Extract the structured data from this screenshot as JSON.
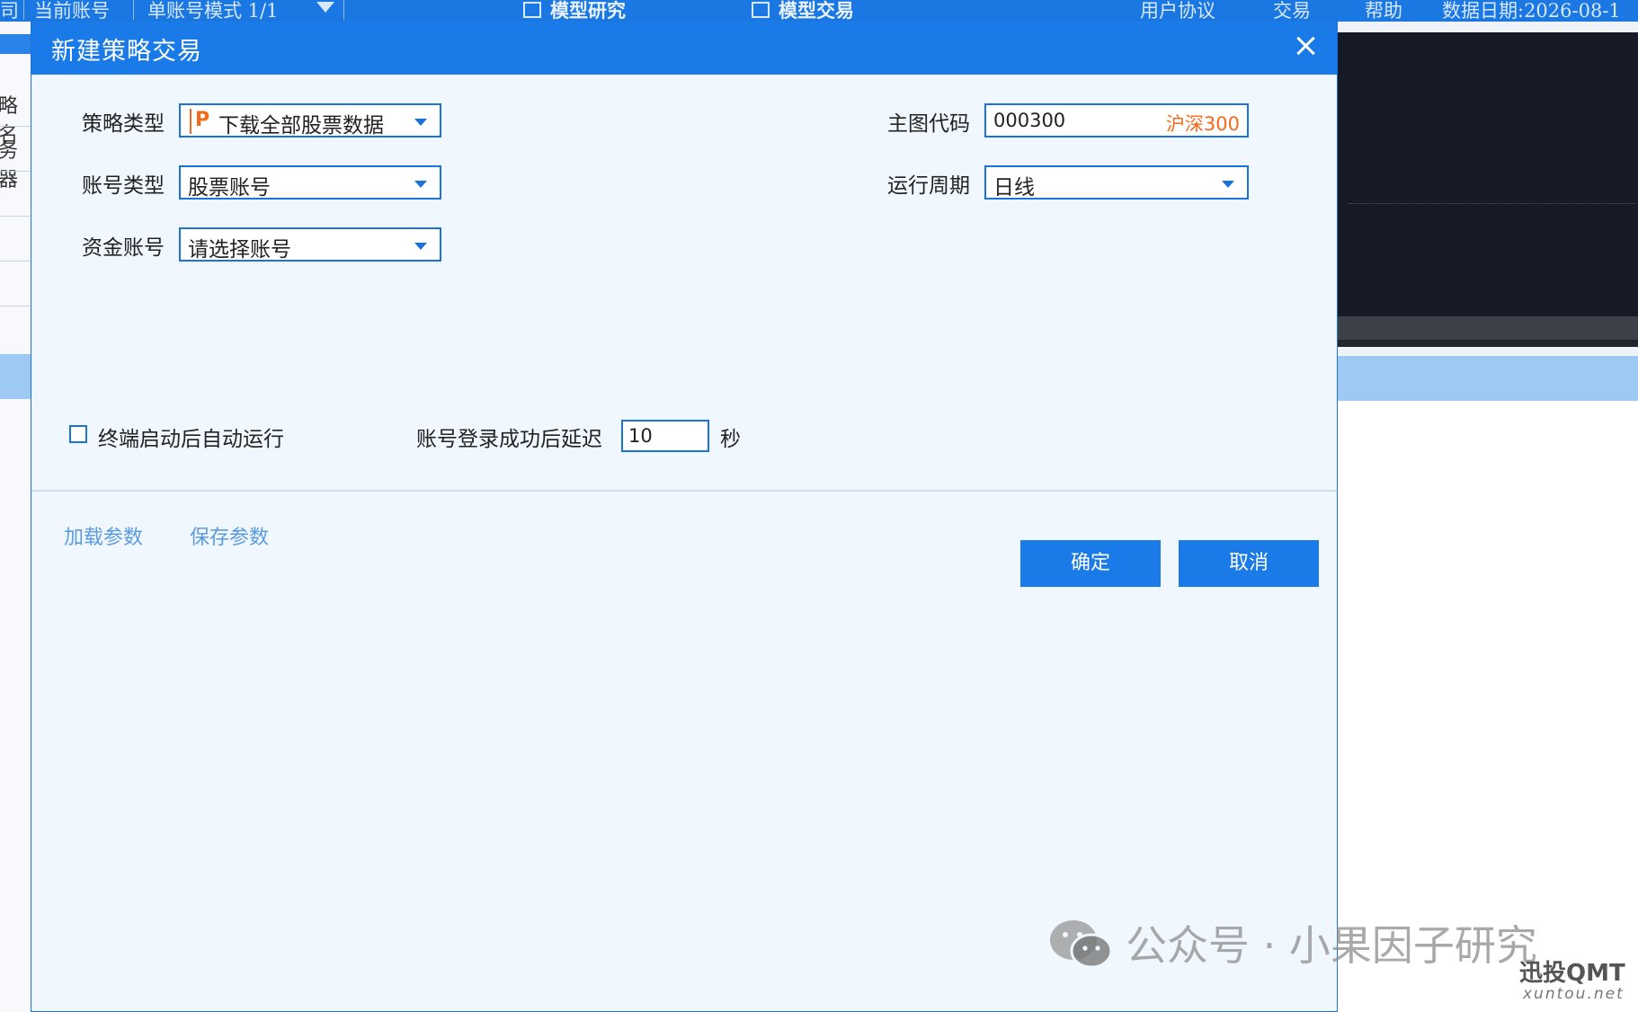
{
  "app": {
    "topbar": {
      "left_fragment": "司",
      "current_account": "当前账号",
      "mode": "单账号模式 1/1",
      "model_research": "模型研究",
      "model_trading": "模型交易",
      "user_agreement": "用户协议",
      "trade": "交易",
      "help": "帮助",
      "data_date": "数据日期:2026-08-1"
    },
    "left_panel": {
      "label1": "略名",
      "label2": "务器"
    }
  },
  "dialog": {
    "title": "新建策略交易",
    "fields": {
      "strategy_type": {
        "label": "策略类型",
        "value": "下载全部股票数据",
        "icon": "python-icon"
      },
      "account_type": {
        "label": "账号类型",
        "value": "股票账号"
      },
      "fund_account": {
        "label": "资金账号",
        "value": "请选择账号"
      },
      "main_code": {
        "label": "主图代码",
        "code": "000300",
        "name": "沪深300"
      },
      "run_period": {
        "label": "运行周期",
        "value": "日线"
      }
    },
    "auto_run": {
      "label": "终端启动后自动运行",
      "checked": false
    },
    "delay": {
      "label": "账号登录成功后延迟",
      "value": "10",
      "unit": "秒"
    },
    "links": {
      "load_params": "加载参数",
      "save_params": "保存参数"
    },
    "buttons": {
      "confirm": "确定",
      "cancel": "取消"
    },
    "colors": {
      "accent": "#1a7ae8",
      "code_name": "#f26a1b",
      "link": "#5b9be0"
    }
  },
  "watermark": {
    "text": "公众号 · 小果因子研究",
    "brand": "迅投QMT",
    "domain": "xuntou.net"
  }
}
